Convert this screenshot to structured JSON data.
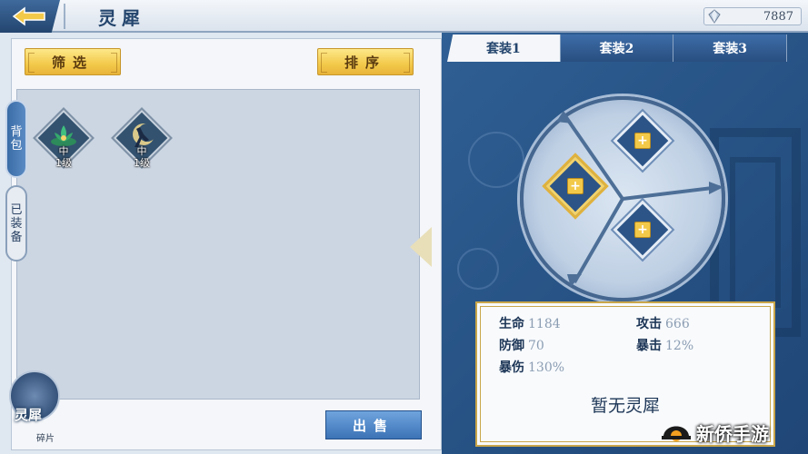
{
  "header": {
    "title": "灵犀",
    "currency_value": "7887"
  },
  "left": {
    "filter_label": "筛选",
    "sort_label": "排序",
    "tabs": [
      {
        "label": "背\n包"
      },
      {
        "label": "已\n装\n备"
      }
    ],
    "items": [
      {
        "grade": "中",
        "level": "1级"
      },
      {
        "grade": "中",
        "level": "1级"
      }
    ],
    "fragment": {
      "label": "灵犀",
      "sub": "碎片"
    },
    "sell_label": "出售"
  },
  "right": {
    "set_tabs": [
      "套装1",
      "套装2",
      "套装3"
    ],
    "active_set": 0,
    "stats": [
      {
        "key": "生命",
        "value": "1184"
      },
      {
        "key": "攻击",
        "value": "666"
      },
      {
        "key": "防御",
        "value": "70"
      },
      {
        "key": "暴击",
        "value": "12%"
      },
      {
        "key": "暴伤",
        "value": "130%"
      }
    ],
    "empty_message": "暂无灵犀"
  },
  "watermark": "新侨手游",
  "colors": {
    "accent_gold": "#f3c94a",
    "panel_blue": "#2f5f94",
    "title_blue": "#24456d"
  }
}
